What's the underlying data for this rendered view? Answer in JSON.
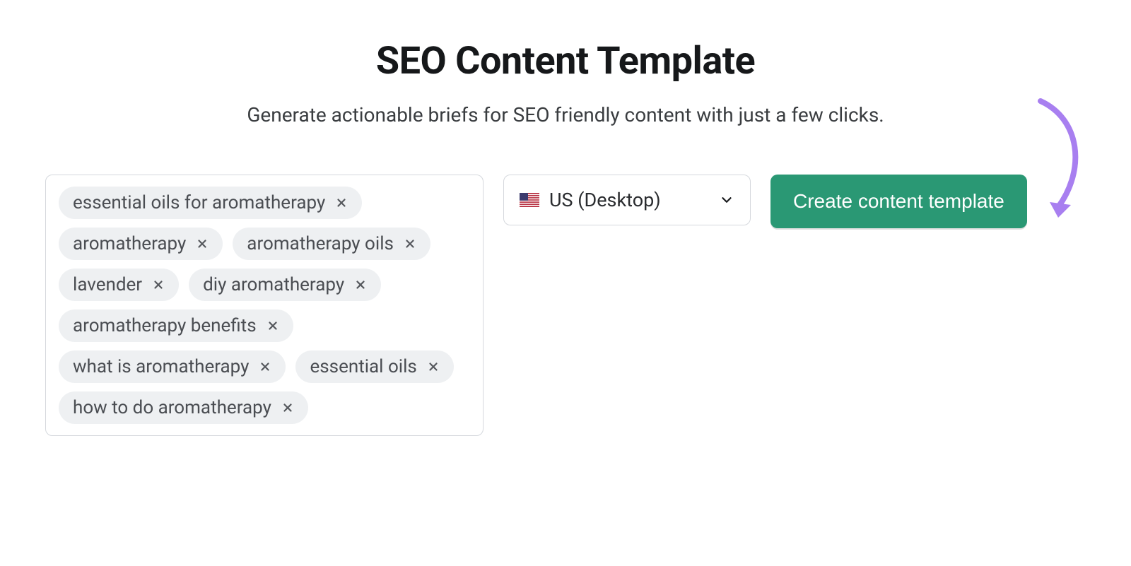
{
  "header": {
    "title": "SEO Content Template",
    "subtitle": "Generate actionable briefs for SEO friendly content with just a few clicks."
  },
  "keywords": {
    "items": [
      "essential oils for aromatherapy",
      "aromatherapy",
      "aromatherapy oils",
      "lavender",
      "diy aromatherapy",
      "aromatherapy benefits",
      "what is aromatherapy",
      "essential oils",
      "how to do aromatherapy"
    ]
  },
  "locale": {
    "label": "US (Desktop)"
  },
  "actions": {
    "create_label": "Create content template"
  }
}
